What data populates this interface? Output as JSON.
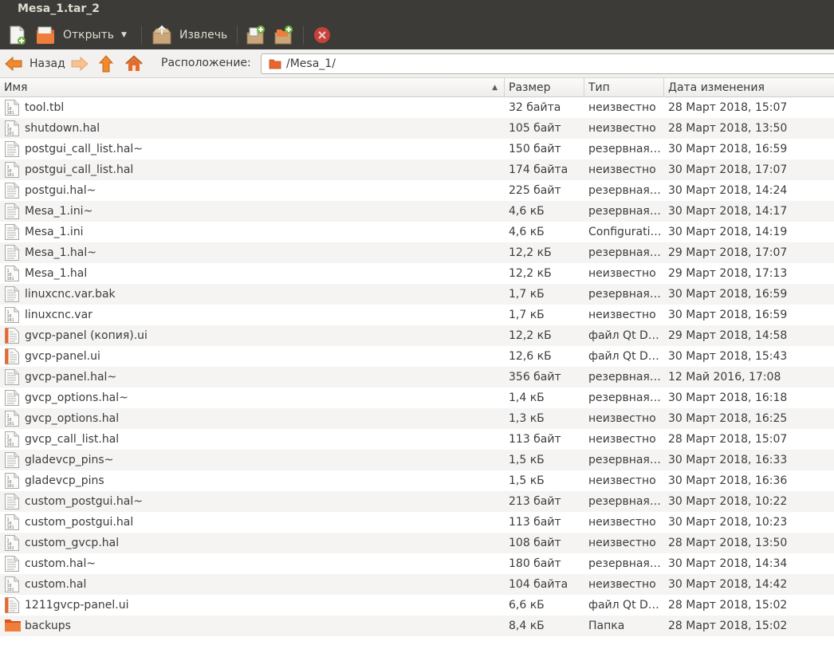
{
  "window": {
    "title": "Mesa_1.tar_2"
  },
  "toolbar": {
    "new_icon": "new-archive-icon",
    "open_label": "Открыть",
    "extract_label": "Извлечь",
    "add_files_icon": "add-files-icon",
    "add_folder_icon": "add-folder-icon",
    "stop_icon": "stop-icon"
  },
  "location": {
    "back_label": "Назад",
    "label": "Расположение:",
    "path": "/Mesa_1/"
  },
  "columns": {
    "name": "Имя",
    "size": "Размер",
    "type": "Тип",
    "modified": "Дата изменения"
  },
  "files": [
    {
      "name": "tool.tbl",
      "size": "32 байта",
      "type": "неизвестно",
      "modified": "28 Март 2018, 15:07",
      "icon": "binary"
    },
    {
      "name": "shutdown.hal",
      "size": "105 байт",
      "type": "неизвестно",
      "modified": "28 Март 2018, 13:50",
      "icon": "binary"
    },
    {
      "name": "postgui_call_list.hal~",
      "size": "150 байт",
      "type": "резервная …",
      "modified": "30 Март 2018, 16:59",
      "icon": "text"
    },
    {
      "name": "postgui_call_list.hal",
      "size": "174 байта",
      "type": "неизвестно",
      "modified": "30 Март 2018, 17:07",
      "icon": "binary"
    },
    {
      "name": "postgui.hal~",
      "size": "225 байт",
      "type": "резервная …",
      "modified": "30 Март 2018, 14:24",
      "icon": "text"
    },
    {
      "name": "Mesa_1.ini~",
      "size": "4,6 кБ",
      "type": "резервная …",
      "modified": "30 Март 2018, 14:17",
      "icon": "text"
    },
    {
      "name": "Mesa_1.ini",
      "size": "4,6 кБ",
      "type": "Configurati…",
      "modified": "30 Март 2018, 14:19",
      "icon": "text"
    },
    {
      "name": "Mesa_1.hal~",
      "size": "12,2 кБ",
      "type": "резервная …",
      "modified": "29 Март 2018, 17:07",
      "icon": "text"
    },
    {
      "name": "Mesa_1.hal",
      "size": "12,2 кБ",
      "type": "неизвестно",
      "modified": "29 Март 2018, 17:13",
      "icon": "binary"
    },
    {
      "name": "linuxcnc.var.bak",
      "size": "1,7 кБ",
      "type": "резервная …",
      "modified": "30 Март 2018, 16:59",
      "icon": "text"
    },
    {
      "name": "linuxcnc.var",
      "size": "1,7 кБ",
      "type": "неизвестно",
      "modified": "30 Март 2018, 16:59",
      "icon": "binary"
    },
    {
      "name": "gvcp-panel (копия).ui",
      "size": "12,2 кБ",
      "type": "файл Qt D…",
      "modified": "29 Март 2018, 14:58",
      "icon": "ui"
    },
    {
      "name": "gvcp-panel.ui",
      "size": "12,6 кБ",
      "type": "файл Qt D…",
      "modified": "30 Март 2018, 15:43",
      "icon": "ui"
    },
    {
      "name": "gvcp-panel.hal~",
      "size": "356 байт",
      "type": "резервная …",
      "modified": "12 Май 2016, 17:08",
      "icon": "text"
    },
    {
      "name": "gvcp_options.hal~",
      "size": "1,4 кБ",
      "type": "резервная …",
      "modified": "30 Март 2018, 16:18",
      "icon": "text"
    },
    {
      "name": "gvcp_options.hal",
      "size": "1,3 кБ",
      "type": "неизвестно",
      "modified": "30 Март 2018, 16:25",
      "icon": "binary"
    },
    {
      "name": "gvcp_call_list.hal",
      "size": "113 байт",
      "type": "неизвестно",
      "modified": "28 Март 2018, 15:07",
      "icon": "binary"
    },
    {
      "name": "gladevcp_pins~",
      "size": "1,5 кБ",
      "type": "резервная …",
      "modified": "30 Март 2018, 16:33",
      "icon": "text"
    },
    {
      "name": "gladevcp_pins",
      "size": "1,5 кБ",
      "type": "неизвестно",
      "modified": "30 Март 2018, 16:36",
      "icon": "binary"
    },
    {
      "name": "custom_postgui.hal~",
      "size": "213 байт",
      "type": "резервная …",
      "modified": "30 Март 2018, 10:22",
      "icon": "text"
    },
    {
      "name": "custom_postgui.hal",
      "size": "113 байт",
      "type": "неизвестно",
      "modified": "30 Март 2018, 10:23",
      "icon": "binary"
    },
    {
      "name": "custom_gvcp.hal",
      "size": "108 байт",
      "type": "неизвестно",
      "modified": "28 Март 2018, 13:50",
      "icon": "binary"
    },
    {
      "name": "custom.hal~",
      "size": "180 байт",
      "type": "резервная …",
      "modified": "30 Март 2018, 14:34",
      "icon": "text"
    },
    {
      "name": "custom.hal",
      "size": "104 байта",
      "type": "неизвестно",
      "modified": "30 Март 2018, 14:42",
      "icon": "binary"
    },
    {
      "name": "1211gvcp-panel.ui",
      "size": "6,6 кБ",
      "type": "файл Qt D…",
      "modified": "28 Март 2018, 15:02",
      "icon": "ui"
    },
    {
      "name": "backups",
      "size": "8,4 кБ",
      "type": "Папка",
      "modified": "28 Март 2018, 15:02",
      "icon": "folder"
    }
  ]
}
